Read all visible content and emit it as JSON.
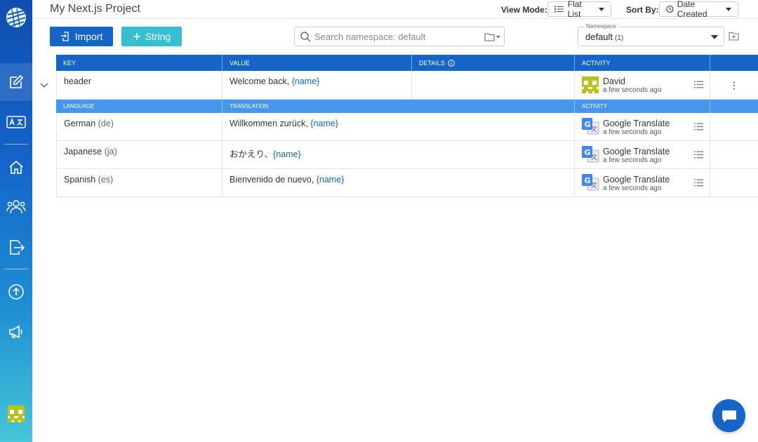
{
  "app": {
    "project_title": "My Next.js Project"
  },
  "toolbar": {
    "view_mode_label": "View Mode:",
    "view_mode_value": "Flat List",
    "sort_by_label": "Sort By:",
    "sort_by_value": "Date Created",
    "import_label": "Import",
    "string_label": "String"
  },
  "search": {
    "placeholder": "Search namespace: default"
  },
  "namespace": {
    "legend": "Namespace",
    "value": "default",
    "count": "(1)"
  },
  "table": {
    "headers": {
      "key": "KEY",
      "value": "VALUE",
      "details": "DETAILS",
      "activity": "ACTIVITY"
    },
    "sub_headers": {
      "language": "LANGUAGE",
      "translation": "TRANSLATION",
      "activity": "ACTIVITY"
    },
    "main_row": {
      "key": "header",
      "value_text": "Welcome back, ",
      "value_placeholder": "{name}",
      "activity_name": "David",
      "activity_time": "a few seconds ago"
    },
    "translations": [
      {
        "language": "German",
        "code": "(de)",
        "text": "Willkommen zurück, ",
        "placeholder": "{name}",
        "activity_name": "Google Translate",
        "activity_time": "a few seconds ago"
      },
      {
        "language": "Japanese",
        "code": "(ja)",
        "text": "おかえり、",
        "placeholder": "{name}",
        "activity_name": "Google Translate",
        "activity_time": "a few seconds ago"
      },
      {
        "language": "Spanish",
        "code": "(es)",
        "text": "Bienvenido de nuevo, ",
        "placeholder": "{name}",
        "activity_name": "Google Translate",
        "activity_time": "a few seconds ago"
      }
    ]
  },
  "colors": {
    "primary": "#1565c9",
    "accent": "#35bfd0",
    "subheader": "#4597ee",
    "avatar": "#b8c41c"
  },
  "icons": {
    "sidebar": [
      "logo-globe-icon",
      "edit-icon",
      "translate-icon",
      "home-icon",
      "users-icon",
      "export-icon",
      "upload-icon",
      "megaphone-icon",
      "user-avatar"
    ],
    "chat": "chat-bubble-icon"
  }
}
